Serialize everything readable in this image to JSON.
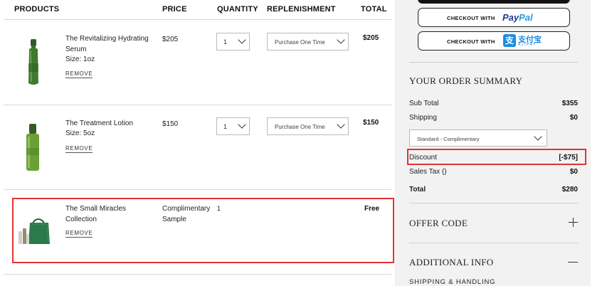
{
  "table_headers": {
    "products": "PRODUCTS",
    "price": "PRICE",
    "quantity": "QUANTITY",
    "replenishment": "REPLENISHMENT",
    "total": "TOTAL"
  },
  "items": [
    {
      "name": "The Revitalizing Hydrating Serum",
      "size": "Size: 1oz",
      "remove": "REMOVE",
      "price": "$205",
      "quantity": "1",
      "replenishment": "Purchase One Time",
      "total": "$205"
    },
    {
      "name": "The Treatment Lotion",
      "size": "Size: 5oz",
      "remove": "REMOVE",
      "price": "$150",
      "quantity": "1",
      "replenishment": "Purchase One Time",
      "total": "$150"
    },
    {
      "name": "The Small Miracles Collection",
      "remove": "REMOVE",
      "price": "Complimentary Sample",
      "quantity": "1",
      "total": "Free"
    }
  ],
  "checkout": {
    "paypal_label": "CHECKOUT WITH",
    "paypal_logo_p": "Pay",
    "paypal_logo_pal": "Pal",
    "alipay_label": "CHECKOUT WITH",
    "alipay_logo_cn": "支付宝",
    "alipay_logo_en": "ALIPAY"
  },
  "summary": {
    "title": "YOUR ORDER SUMMARY",
    "subtotal_label": "Sub Total",
    "subtotal_value": "$355",
    "shipping_label": "Shipping",
    "shipping_value": "$0",
    "shipping_option": "Standard - Complimentary",
    "discount_label": "Discount",
    "discount_value": "[-$75]",
    "tax_label": "Sales Tax ()",
    "tax_value": "$0",
    "total_label": "Total",
    "total_value": "$280"
  },
  "offer_code": {
    "title": "OFFER CODE"
  },
  "additional_info": {
    "title": "ADDITIONAL INFO",
    "sub": "SHIPPING & HANDLING"
  },
  "colors": {
    "highlight": "#e03434",
    "sidebar_bg": "#f2f2f2",
    "paypal_dark": "#1b3e8d",
    "paypal_light": "#2b9ad7",
    "alipay_blue": "#1d8ee0",
    "product_green": "#3f7a2c"
  },
  "icons": [
    "chevron-down-icon",
    "plus-icon",
    "minus-icon",
    "paypal-logo",
    "alipay-logo"
  ]
}
